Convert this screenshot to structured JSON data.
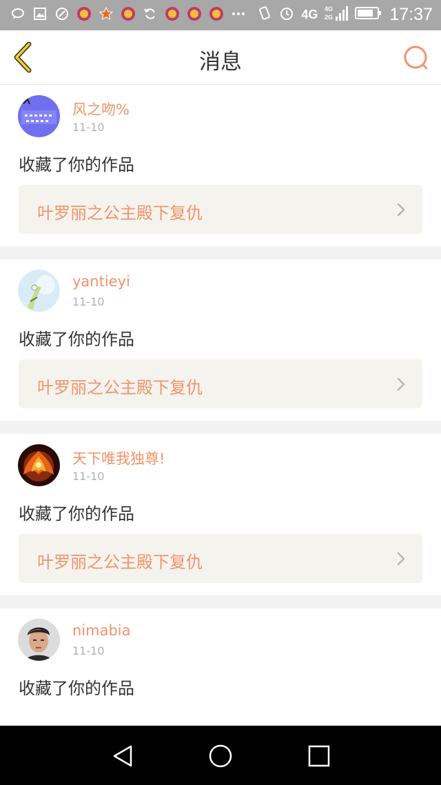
{
  "status_bar": {
    "time": "17:37",
    "network": "4G",
    "network2": "4G 2G",
    "icons": [
      "chat-icon",
      "gallery-icon",
      "app-icon",
      "app-icon",
      "star-icon",
      "app-icon",
      "sync-icon",
      "app-icon",
      "app-icon",
      "app-icon",
      "more-icon"
    ]
  },
  "header": {
    "title": "消息",
    "back_icon": "chevron-left-icon",
    "search_icon": "search-icon",
    "accent": "#f0936a"
  },
  "notifications": [
    {
      "username": "风之吻%",
      "date": "11-10",
      "action": "收藏了你的作品",
      "work_title": "叶罗丽之公主殿下复仇"
    },
    {
      "username": "yantieyi",
      "date": "11-10",
      "action": "收藏了你的作品",
      "work_title": "叶罗丽之公主殿下复仇"
    },
    {
      "username": "天下唯我独尊!",
      "date": "11-10",
      "action": "收藏了你的作品",
      "work_title": "叶罗丽之公主殿下复仇"
    },
    {
      "username": "nimabia",
      "date": "11-10",
      "action": "收藏了你的作品",
      "work_title": ""
    }
  ],
  "nav_bar": {
    "back": "triangle-back-icon",
    "home": "circle-home-icon",
    "recent": "square-recent-icon"
  }
}
